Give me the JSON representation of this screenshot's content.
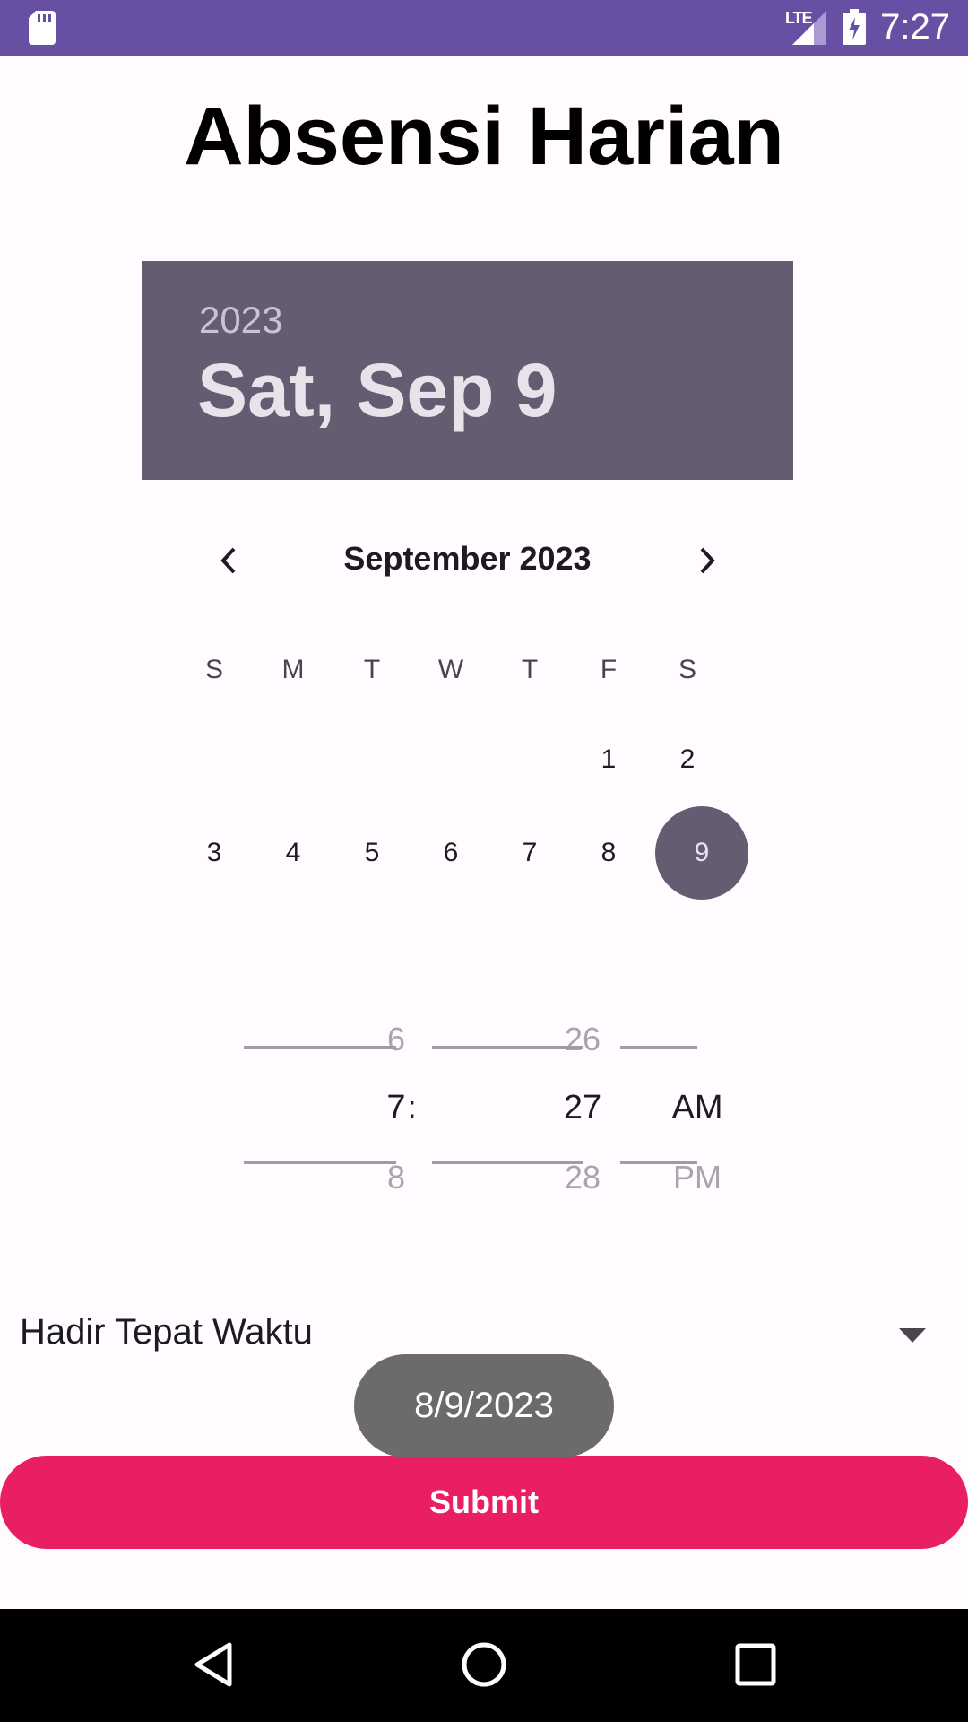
{
  "status_bar": {
    "network": "LTE",
    "time": "7:27",
    "icons": [
      "sd-card-icon",
      "signal-icon",
      "battery-charging-icon"
    ]
  },
  "title": "Absensi Harian",
  "date_picker": {
    "year": "2023",
    "selected_date": "Sat, Sep 9",
    "month_label": "September 2023",
    "weekdays": [
      "S",
      "M",
      "T",
      "W",
      "T",
      "F",
      "S"
    ],
    "week1": [
      "",
      "",
      "",
      "",
      "",
      "1",
      "2"
    ],
    "week2": [
      "3",
      "4",
      "5",
      "6",
      "7",
      "8",
      "9"
    ],
    "selected_day": "9",
    "accent_color": "#645d72"
  },
  "time_picker": {
    "hour": {
      "prev": "6",
      "current": "7",
      "next": "8"
    },
    "separator": ":",
    "minute": {
      "prev": "26",
      "current": "27",
      "next": "28"
    },
    "period": {
      "prev": "",
      "current": "AM",
      "next": "PM"
    }
  },
  "dropdown": {
    "value": "Hadir Tepat Waktu"
  },
  "toast": "8/9/2023",
  "submit": {
    "label": "Submit",
    "color": "#e91e63"
  },
  "nav_bar": {
    "icons": [
      "back-icon",
      "home-icon",
      "recents-icon"
    ]
  }
}
